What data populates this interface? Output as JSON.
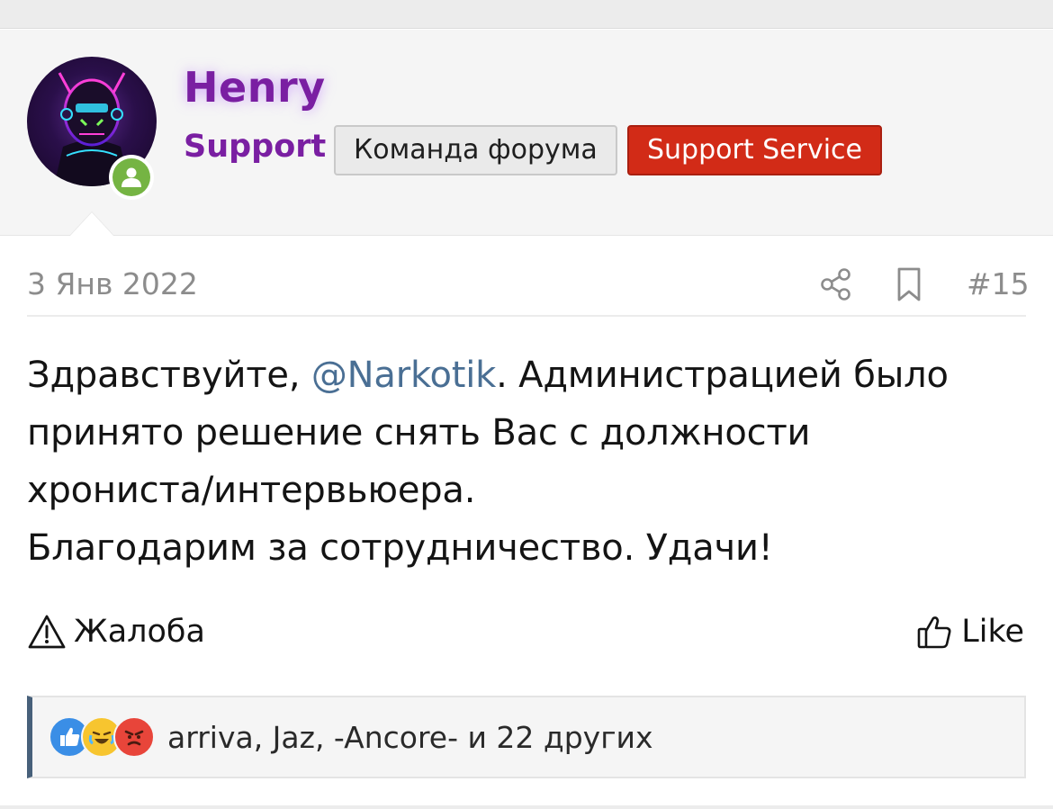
{
  "user": {
    "name": "Henry",
    "title": "Support",
    "banners": [
      "Команда форума",
      "Support Service"
    ],
    "avatar_icon": "cyberpunk-avatar",
    "status_icon": "online-user-icon",
    "name_color": "#7a1fa2"
  },
  "post": {
    "date": "3 Янв 2022",
    "number": "#15",
    "share_icon": "share-icon",
    "bookmark_icon": "bookmark-icon",
    "message": {
      "greeting": "Здравствуйте, ",
      "mention": "@Narkotik",
      "line1_rest": ". Администрацией было",
      "line2": "принято решение снять Вас с должности",
      "line3": "хрониста/интервьюера.",
      "line4": "Благодарим за сотрудничество. Удачи!"
    },
    "actions": {
      "report_label": "Жалоба",
      "like_label": "Like"
    },
    "reactions": {
      "icons": [
        "like-reaction-icon",
        "laugh-reaction-icon",
        "angry-reaction-icon"
      ],
      "summary": "arriva, Jaz, -Ancore- и 22 других"
    }
  },
  "colors": {
    "accent_purple": "#7a1fa2",
    "support_red": "#d22b17",
    "mention_blue": "#4a6f94",
    "online_green": "#75b443"
  }
}
